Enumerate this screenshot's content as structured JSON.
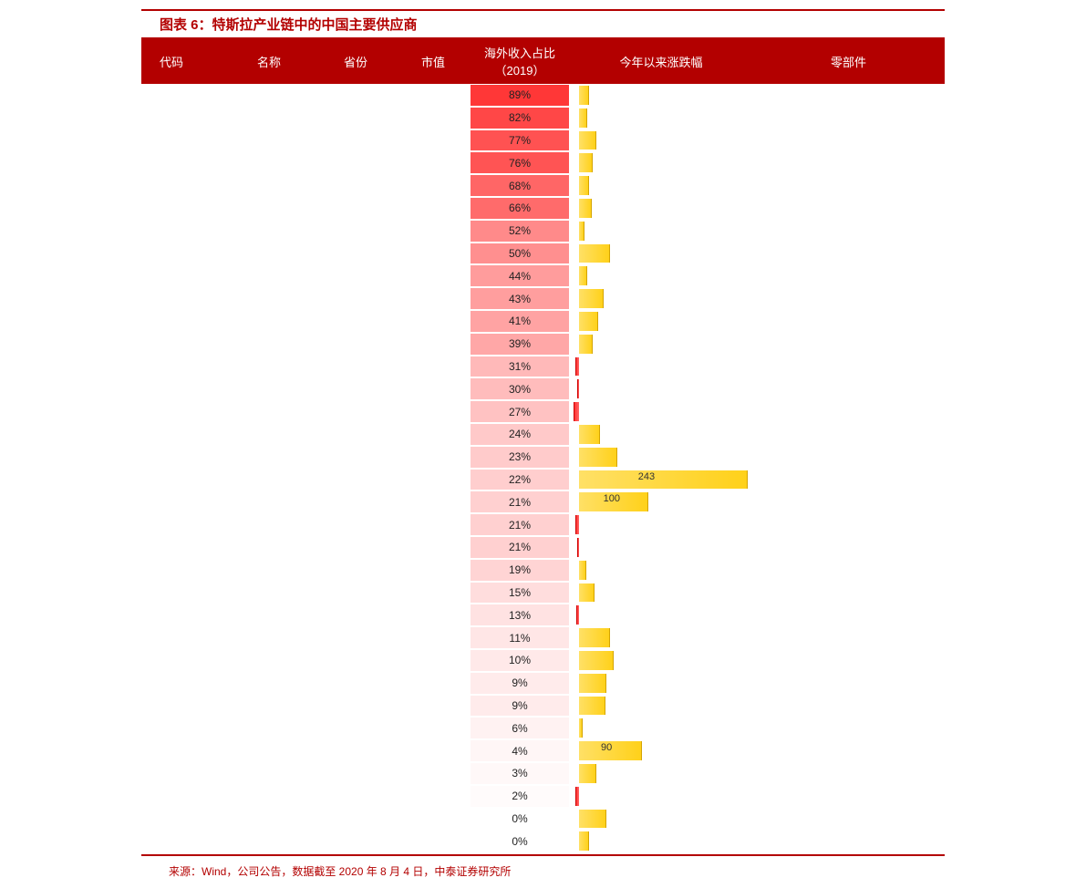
{
  "title": "图表 6：特斯拉产业链中的中国主要供应商",
  "headers": {
    "code": "代码",
    "name": "名称",
    "prov": "省份",
    "mktcap": "市值",
    "ratio": "海外收入占比（2019）",
    "chg": "今年以来涨跌幅",
    "part": "零部件"
  },
  "source": "来源：Wind，公司公告，数据截至 2020 年 8 月 4 日，中泰证券研究所",
  "chart_data": {
    "type": "table",
    "title": "特斯拉产业链中的中国主要供应商",
    "columns": [
      "代码",
      "名称",
      "省份",
      "市值",
      "海外收入占比（2019）",
      "今年以来涨跌幅",
      "零部件"
    ],
    "ratio_scale": {
      "min": 0,
      "max": 89
    },
    "chg_scale_max": 243,
    "rows": [
      {
        "code": "",
        "name": "",
        "prov": "",
        "mktcap": "",
        "ratio": 89,
        "chg": 15,
        "part": ""
      },
      {
        "code": "",
        "name": "",
        "prov": "",
        "mktcap": "",
        "ratio": 82,
        "chg": 12,
        "part": ""
      },
      {
        "code": "",
        "name": "",
        "prov": "",
        "mktcap": "",
        "ratio": 77,
        "chg": 25,
        "part": ""
      },
      {
        "code": "",
        "name": "",
        "prov": "",
        "mktcap": "",
        "ratio": 76,
        "chg": 20,
        "part": ""
      },
      {
        "code": "",
        "name": "",
        "prov": "",
        "mktcap": "",
        "ratio": 68,
        "chg": 15,
        "part": ""
      },
      {
        "code": "",
        "name": "",
        "prov": "",
        "mktcap": "",
        "ratio": 66,
        "chg": 18,
        "part": ""
      },
      {
        "code": "",
        "name": "",
        "prov": "",
        "mktcap": "",
        "ratio": 52,
        "chg": 8,
        "part": ""
      },
      {
        "code": "",
        "name": "",
        "prov": "",
        "mktcap": "",
        "ratio": 50,
        "chg": 45,
        "part": ""
      },
      {
        "code": "",
        "name": "",
        "prov": "",
        "mktcap": "",
        "ratio": 44,
        "chg": 12,
        "part": ""
      },
      {
        "code": "",
        "name": "",
        "prov": "",
        "mktcap": "",
        "ratio": 43,
        "chg": 35,
        "part": ""
      },
      {
        "code": "",
        "name": "",
        "prov": "",
        "mktcap": "",
        "ratio": 41,
        "chg": 28,
        "part": ""
      },
      {
        "code": "",
        "name": "",
        "prov": "",
        "mktcap": "",
        "ratio": 39,
        "chg": 20,
        "part": ""
      },
      {
        "code": "",
        "name": "",
        "prov": "",
        "mktcap": "",
        "ratio": 31,
        "chg": -5,
        "part": ""
      },
      {
        "code": "",
        "name": "",
        "prov": "",
        "mktcap": "",
        "ratio": 30,
        "chg": -3,
        "part": ""
      },
      {
        "code": "",
        "name": "",
        "prov": "",
        "mktcap": "",
        "ratio": 27,
        "chg": -8,
        "part": ""
      },
      {
        "code": "",
        "name": "",
        "prov": "",
        "mktcap": "",
        "ratio": 24,
        "chg": 30,
        "part": ""
      },
      {
        "code": "",
        "name": "",
        "prov": "",
        "mktcap": "",
        "ratio": 23,
        "chg": 55,
        "part": ""
      },
      {
        "code": "",
        "name": "",
        "prov": "",
        "mktcap": "",
        "ratio": 22,
        "chg": 243,
        "part": ""
      },
      {
        "code": "",
        "name": "",
        "prov": "",
        "mktcap": "",
        "ratio": 21,
        "chg": 100,
        "part": ""
      },
      {
        "code": "",
        "name": "",
        "prov": "",
        "mktcap": "",
        "ratio": 21,
        "chg": -5,
        "part": ""
      },
      {
        "code": "",
        "name": "",
        "prov": "",
        "mktcap": "",
        "ratio": 21,
        "chg": -3,
        "part": ""
      },
      {
        "code": "",
        "name": "",
        "prov": "",
        "mktcap": "",
        "ratio": 19,
        "chg": 10,
        "part": ""
      },
      {
        "code": "",
        "name": "",
        "prov": "",
        "mktcap": "",
        "ratio": 15,
        "chg": 22,
        "part": ""
      },
      {
        "code": "",
        "name": "",
        "prov": "",
        "mktcap": "",
        "ratio": 13,
        "chg": -4,
        "part": ""
      },
      {
        "code": "",
        "name": "",
        "prov": "",
        "mktcap": "",
        "ratio": 11,
        "chg": 45,
        "part": ""
      },
      {
        "code": "",
        "name": "",
        "prov": "",
        "mktcap": "",
        "ratio": 10,
        "chg": 50,
        "part": ""
      },
      {
        "code": "",
        "name": "",
        "prov": "",
        "mktcap": "",
        "ratio": 9,
        "chg": 40,
        "part": ""
      },
      {
        "code": "",
        "name": "",
        "prov": "",
        "mktcap": "",
        "ratio": 9,
        "chg": 38,
        "part": ""
      },
      {
        "code": "",
        "name": "",
        "prov": "",
        "mktcap": "",
        "ratio": 6,
        "chg": 5,
        "part": ""
      },
      {
        "code": "",
        "name": "",
        "prov": "",
        "mktcap": "",
        "ratio": 4,
        "chg": 90,
        "part": ""
      },
      {
        "code": "",
        "name": "",
        "prov": "",
        "mktcap": "",
        "ratio": 3,
        "chg": 25,
        "part": ""
      },
      {
        "code": "",
        "name": "",
        "prov": "",
        "mktcap": "",
        "ratio": 2,
        "chg": -5,
        "part": ""
      },
      {
        "code": "",
        "name": "",
        "prov": "",
        "mktcap": "",
        "ratio": 0,
        "chg": 40,
        "part": ""
      },
      {
        "code": "",
        "name": "",
        "prov": "",
        "mktcap": "",
        "ratio": 0,
        "chg": 15,
        "part": ""
      }
    ]
  }
}
